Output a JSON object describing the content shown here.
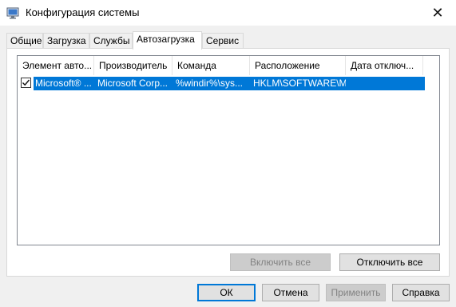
{
  "window": {
    "title": "Конфигурация системы",
    "close_glyph": "✕"
  },
  "tabs": [
    {
      "label": "Общие"
    },
    {
      "label": "Загрузка"
    },
    {
      "label": "Службы"
    },
    {
      "label": "Автозагрузка"
    },
    {
      "label": "Сервис"
    }
  ],
  "active_tab": "Автозагрузка",
  "startup_table": {
    "columns": [
      "Элемент авто...",
      "Производитель",
      "Команда",
      "Расположение",
      "Дата отключ..."
    ],
    "rows": [
      {
        "checked": true,
        "selected": true,
        "item": "Microsoft® ...",
        "manufacturer": "Microsoft Corp...",
        "command": "%windir%\\sys...",
        "location": "HKLM\\SOFTWARE\\M...",
        "disabled_date": ""
      }
    ]
  },
  "panel_buttons": {
    "enable_all": "Включить все",
    "disable_all": "Отключить все"
  },
  "dialog_buttons": {
    "ok": "ОК",
    "cancel": "Отмена",
    "apply": "Применить",
    "help": "Справка"
  },
  "colors": {
    "selection": "#0078d7",
    "default_button_border": "#0078d7"
  },
  "icons": {
    "app": "system-config-icon",
    "close": "close-icon",
    "check": "checkmark-icon"
  }
}
